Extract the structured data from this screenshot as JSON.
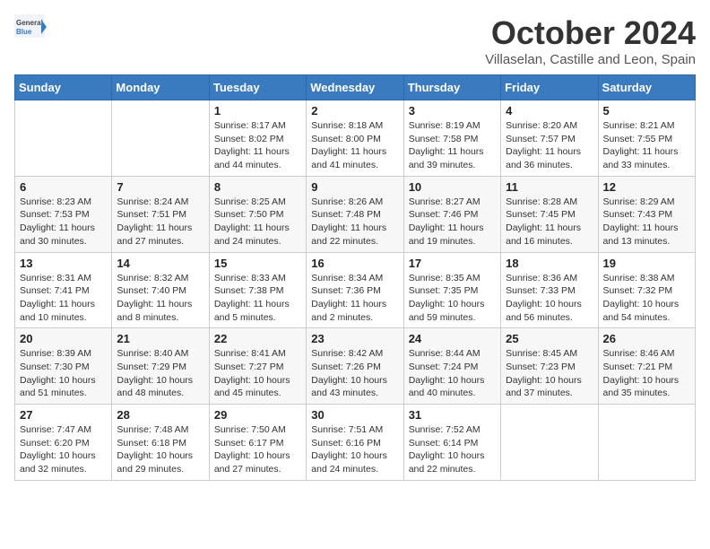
{
  "logo": {
    "general": "General",
    "blue": "Blue"
  },
  "title": "October 2024",
  "location": "Villaselan, Castille and Leon, Spain",
  "days_of_week": [
    "Sunday",
    "Monday",
    "Tuesday",
    "Wednesday",
    "Thursday",
    "Friday",
    "Saturday"
  ],
  "weeks": [
    [
      {
        "day": "",
        "info": ""
      },
      {
        "day": "",
        "info": ""
      },
      {
        "day": "1",
        "info": "Sunrise: 8:17 AM\nSunset: 8:02 PM\nDaylight: 11 hours and 44 minutes."
      },
      {
        "day": "2",
        "info": "Sunrise: 8:18 AM\nSunset: 8:00 PM\nDaylight: 11 hours and 41 minutes."
      },
      {
        "day": "3",
        "info": "Sunrise: 8:19 AM\nSunset: 7:58 PM\nDaylight: 11 hours and 39 minutes."
      },
      {
        "day": "4",
        "info": "Sunrise: 8:20 AM\nSunset: 7:57 PM\nDaylight: 11 hours and 36 minutes."
      },
      {
        "day": "5",
        "info": "Sunrise: 8:21 AM\nSunset: 7:55 PM\nDaylight: 11 hours and 33 minutes."
      }
    ],
    [
      {
        "day": "6",
        "info": "Sunrise: 8:23 AM\nSunset: 7:53 PM\nDaylight: 11 hours and 30 minutes."
      },
      {
        "day": "7",
        "info": "Sunrise: 8:24 AM\nSunset: 7:51 PM\nDaylight: 11 hours and 27 minutes."
      },
      {
        "day": "8",
        "info": "Sunrise: 8:25 AM\nSunset: 7:50 PM\nDaylight: 11 hours and 24 minutes."
      },
      {
        "day": "9",
        "info": "Sunrise: 8:26 AM\nSunset: 7:48 PM\nDaylight: 11 hours and 22 minutes."
      },
      {
        "day": "10",
        "info": "Sunrise: 8:27 AM\nSunset: 7:46 PM\nDaylight: 11 hours and 19 minutes."
      },
      {
        "day": "11",
        "info": "Sunrise: 8:28 AM\nSunset: 7:45 PM\nDaylight: 11 hours and 16 minutes."
      },
      {
        "day": "12",
        "info": "Sunrise: 8:29 AM\nSunset: 7:43 PM\nDaylight: 11 hours and 13 minutes."
      }
    ],
    [
      {
        "day": "13",
        "info": "Sunrise: 8:31 AM\nSunset: 7:41 PM\nDaylight: 11 hours and 10 minutes."
      },
      {
        "day": "14",
        "info": "Sunrise: 8:32 AM\nSunset: 7:40 PM\nDaylight: 11 hours and 8 minutes."
      },
      {
        "day": "15",
        "info": "Sunrise: 8:33 AM\nSunset: 7:38 PM\nDaylight: 11 hours and 5 minutes."
      },
      {
        "day": "16",
        "info": "Sunrise: 8:34 AM\nSunset: 7:36 PM\nDaylight: 11 hours and 2 minutes."
      },
      {
        "day": "17",
        "info": "Sunrise: 8:35 AM\nSunset: 7:35 PM\nDaylight: 10 hours and 59 minutes."
      },
      {
        "day": "18",
        "info": "Sunrise: 8:36 AM\nSunset: 7:33 PM\nDaylight: 10 hours and 56 minutes."
      },
      {
        "day": "19",
        "info": "Sunrise: 8:38 AM\nSunset: 7:32 PM\nDaylight: 10 hours and 54 minutes."
      }
    ],
    [
      {
        "day": "20",
        "info": "Sunrise: 8:39 AM\nSunset: 7:30 PM\nDaylight: 10 hours and 51 minutes."
      },
      {
        "day": "21",
        "info": "Sunrise: 8:40 AM\nSunset: 7:29 PM\nDaylight: 10 hours and 48 minutes."
      },
      {
        "day": "22",
        "info": "Sunrise: 8:41 AM\nSunset: 7:27 PM\nDaylight: 10 hours and 45 minutes."
      },
      {
        "day": "23",
        "info": "Sunrise: 8:42 AM\nSunset: 7:26 PM\nDaylight: 10 hours and 43 minutes."
      },
      {
        "day": "24",
        "info": "Sunrise: 8:44 AM\nSunset: 7:24 PM\nDaylight: 10 hours and 40 minutes."
      },
      {
        "day": "25",
        "info": "Sunrise: 8:45 AM\nSunset: 7:23 PM\nDaylight: 10 hours and 37 minutes."
      },
      {
        "day": "26",
        "info": "Sunrise: 8:46 AM\nSunset: 7:21 PM\nDaylight: 10 hours and 35 minutes."
      }
    ],
    [
      {
        "day": "27",
        "info": "Sunrise: 7:47 AM\nSunset: 6:20 PM\nDaylight: 10 hours and 32 minutes."
      },
      {
        "day": "28",
        "info": "Sunrise: 7:48 AM\nSunset: 6:18 PM\nDaylight: 10 hours and 29 minutes."
      },
      {
        "day": "29",
        "info": "Sunrise: 7:50 AM\nSunset: 6:17 PM\nDaylight: 10 hours and 27 minutes."
      },
      {
        "day": "30",
        "info": "Sunrise: 7:51 AM\nSunset: 6:16 PM\nDaylight: 10 hours and 24 minutes."
      },
      {
        "day": "31",
        "info": "Sunrise: 7:52 AM\nSunset: 6:14 PM\nDaylight: 10 hours and 22 minutes."
      },
      {
        "day": "",
        "info": ""
      },
      {
        "day": "",
        "info": ""
      }
    ]
  ]
}
